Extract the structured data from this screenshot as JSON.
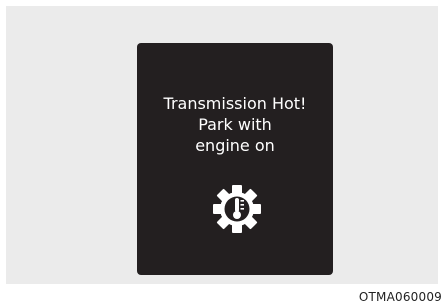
{
  "warning": {
    "line1": "Transmission Hot!",
    "line2": "Park with",
    "line3": "engine on",
    "icon": "transmission-temperature-icon"
  },
  "figure_code": "OTMA060009",
  "colors": {
    "background": "#ebebeb",
    "panel": "#231f20",
    "text": "#ffffff"
  }
}
